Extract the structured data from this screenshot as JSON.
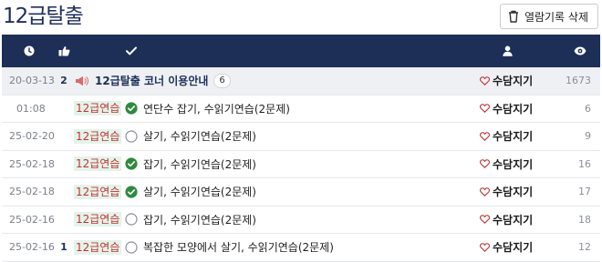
{
  "page": {
    "title": "12급탈출"
  },
  "toolbar": {
    "clear_history_label": "열람기록 삭제",
    "clear_icon": "trash-icon"
  },
  "table": {
    "header_icons": [
      "clock-icon",
      "thumbs-up-icon",
      "check-icon",
      "user-icon",
      "eye-icon"
    ],
    "notice": {
      "date": "20-03-13",
      "recommend": "2",
      "title": "12급탈출 코너 이용안내",
      "comments": "6",
      "author": "수담지기",
      "views": "1673"
    },
    "rows": [
      {
        "date": "01:08",
        "recommend": "",
        "tag": "12급연습",
        "solved": true,
        "title": "연단수 잡기, 수읽기연습(2문제)",
        "author": "수담지기",
        "views": "6"
      },
      {
        "date": "25-02-20",
        "recommend": "",
        "tag": "12급연습",
        "solved": false,
        "title": "살기, 수읽기연습(2문제)",
        "author": "수담지기",
        "views": "9"
      },
      {
        "date": "25-02-18",
        "recommend": "",
        "tag": "12급연습",
        "solved": true,
        "title": "잡기, 수읽기연습(2문제)",
        "author": "수담지기",
        "views": "16"
      },
      {
        "date": "25-02-18",
        "recommend": "",
        "tag": "12급연습",
        "solved": true,
        "title": "살기, 수읽기연습(2문제)",
        "author": "수담지기",
        "views": "17"
      },
      {
        "date": "25-02-16",
        "recommend": "",
        "tag": "12급연습",
        "solved": false,
        "title": "잡기, 수읽기연습(2문제)",
        "author": "수담지기",
        "views": "18"
      },
      {
        "date": "25-02-16",
        "recommend": "1",
        "tag": "12급연습",
        "solved": false,
        "title": "복잡한 모양에서 살기, 수읽기연습(2문제)",
        "author": "수담지기",
        "views": "12"
      }
    ]
  },
  "colors": {
    "header_bg": "#1d2f57",
    "solved_green": "#2e8b3e",
    "tag_red": "#c23434",
    "heart_red": "#c23434"
  }
}
